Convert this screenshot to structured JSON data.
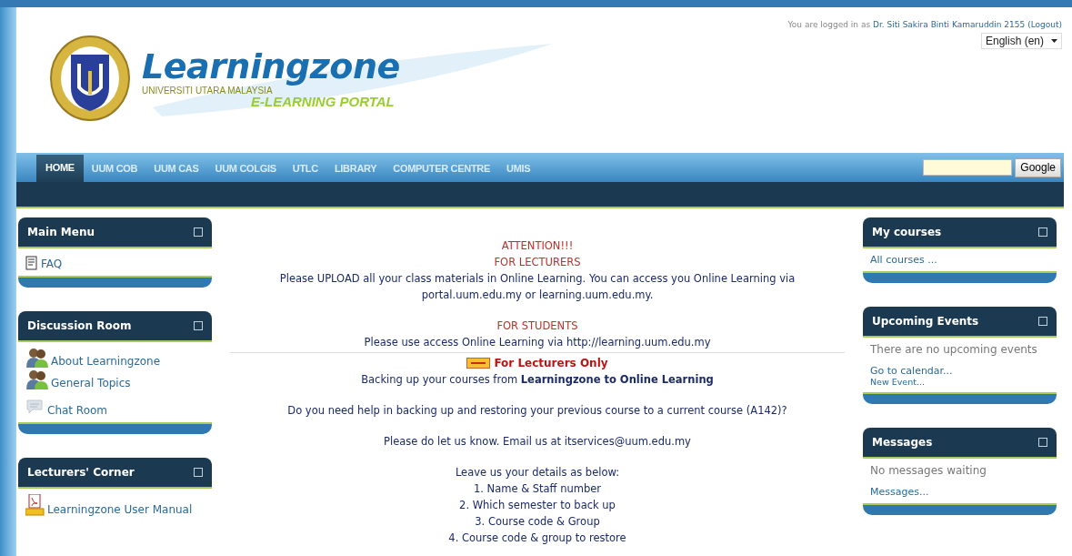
{
  "header": {
    "title": "Learningzone",
    "subtitle": "UNIVERSITI UTARA MALAYSIA",
    "tagline": "E-LEARNING PORTAL"
  },
  "login": {
    "prefix": "You are logged in as",
    "user": "Dr. Siti Sakira Binti Kamaruddin 2155",
    "logout": "(Logout)"
  },
  "language": {
    "value": "English (en)"
  },
  "nav": [
    {
      "label": "HOME",
      "selected": true
    },
    {
      "label": "UUM COB",
      "selected": false
    },
    {
      "label": "UUM CAS",
      "selected": false
    },
    {
      "label": "UUM COLGIS",
      "selected": false
    },
    {
      "label": "UTLC",
      "selected": false
    },
    {
      "label": "LIBRARY",
      "selected": false
    },
    {
      "label": "COMPUTER CENTRE",
      "selected": false
    },
    {
      "label": "UMIS",
      "selected": false
    }
  ],
  "search": {
    "button": "Google"
  },
  "left_blocks": [
    {
      "title": "Main Menu",
      "items": [
        {
          "kind": "document",
          "label": "FAQ"
        }
      ]
    },
    {
      "title": "Discussion Room",
      "items": [
        {
          "kind": "people",
          "label": "About Learningzone"
        },
        {
          "kind": "people",
          "label": "General Topics"
        },
        {
          "kind": "chat",
          "label": "Chat Room"
        }
      ]
    },
    {
      "title": "Lecturers' Corner",
      "items": [
        {
          "kind": "pdf",
          "label": "Learningzone User Manual"
        }
      ]
    }
  ],
  "center": [
    {
      "kind": "paragraph",
      "lines": [
        {
          "kind": "alert",
          "text": "ATTENTION!!!"
        },
        {
          "kind": "alert",
          "text": "FOR LECTURERS"
        },
        {
          "kind": "text",
          "text": "Please UPLOAD all your class materials in Online Learning. You can access you Online Learning via portal.uum.edu.my or learning.uum.edu.my."
        }
      ]
    },
    {
      "kind": "paragraph",
      "lines": [
        {
          "kind": "alert",
          "text": "FOR STUDENTS"
        },
        {
          "kind": "text",
          "text": "Please use access Online Learning via http://learning.uum.edu.my"
        }
      ]
    },
    {
      "kind": "divider"
    },
    {
      "kind": "paragraph",
      "lines": [
        {
          "kind": "new",
          "text": "For Lecturers Only"
        },
        {
          "kind": "text",
          "text": "Backing up your courses from **Learningzone to Online Learning**"
        }
      ]
    },
    {
      "kind": "paragraph",
      "lines": [
        {
          "kind": "text",
          "text": "Do you need help in backing up and restoring your previous course to a current course (A142)?"
        }
      ]
    },
    {
      "kind": "paragraph",
      "lines": [
        {
          "kind": "text",
          "text": "Please do let us know. Email us at itservices@uum.edu.my"
        }
      ]
    },
    {
      "kind": "paragraph",
      "lines": [
        {
          "kind": "text",
          "text": "Leave us your details as below:"
        },
        {
          "kind": "text",
          "text": "1. Name & Staff number"
        },
        {
          "kind": "text",
          "text": "2. Which semester to back up"
        },
        {
          "kind": "text",
          "text": "3. Course code & Group"
        },
        {
          "kind": "text",
          "text": "4. Course code & group to restore"
        }
      ]
    }
  ],
  "right_blocks": [
    {
      "title": "My courses",
      "items": [
        {
          "kind": "link",
          "text": "All courses ..."
        }
      ]
    },
    {
      "title": "Upcoming Events",
      "items": [
        {
          "kind": "note",
          "text": "There are no upcoming events"
        },
        {
          "kind": "link",
          "text": "Go to calendar..."
        },
        {
          "kind": "small-link",
          "text": "New Event..."
        }
      ]
    },
    {
      "title": "Messages",
      "items": [
        {
          "kind": "note",
          "text": "No messages waiting"
        },
        {
          "kind": "link",
          "text": "Messages..."
        }
      ]
    }
  ]
}
